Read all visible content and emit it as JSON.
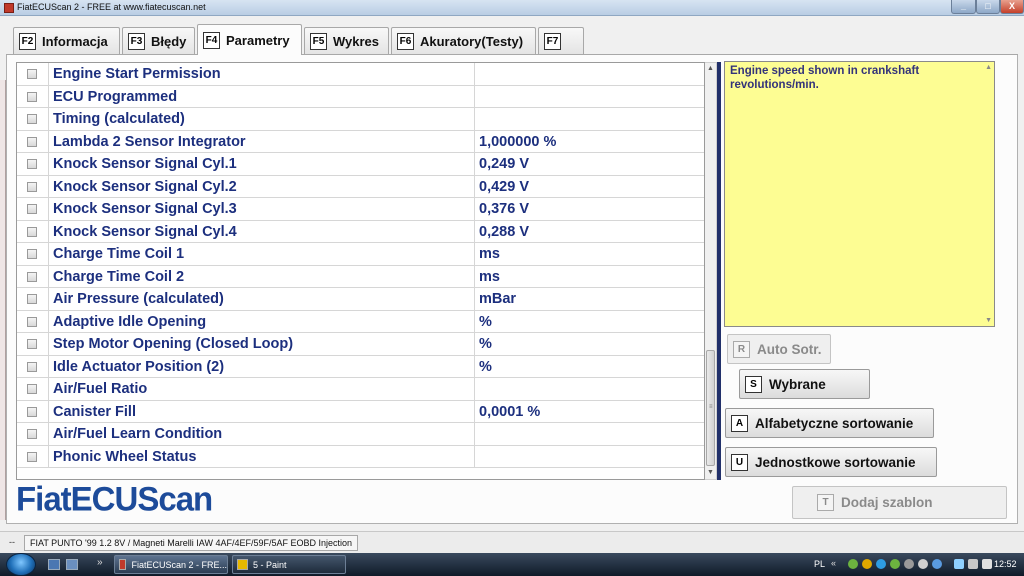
{
  "window": {
    "title": "FiatECUScan 2 - FREE at www.fiatecuscan.net",
    "min_label": "_",
    "max_label": "□",
    "close_label": "X"
  },
  "tabs": [
    {
      "key": "F2",
      "label": "Informacja"
    },
    {
      "key": "F3",
      "label": "Błędy"
    },
    {
      "key": "F4",
      "label": "Parametry"
    },
    {
      "key": "F5",
      "label": "Wykres"
    },
    {
      "key": "F6",
      "label": "Akuratory(Testy)"
    },
    {
      "key": "F7",
      "label": ""
    }
  ],
  "active_tab": "Parametry",
  "parameters": [
    {
      "name": "Engine Start Permission",
      "value": ""
    },
    {
      "name": "ECU Programmed",
      "value": ""
    },
    {
      "name": "Timing (calculated)",
      "value": ""
    },
    {
      "name": "Lambda 2 Sensor Integrator",
      "value": "1,000000 %"
    },
    {
      "name": "Knock Sensor Signal Cyl.1",
      "value": "0,249 V"
    },
    {
      "name": "Knock Sensor Signal Cyl.2",
      "value": "0,429 V"
    },
    {
      "name": "Knock Sensor Signal Cyl.3",
      "value": "0,376 V"
    },
    {
      "name": "Knock Sensor Signal Cyl.4",
      "value": "0,288 V"
    },
    {
      "name": "Charge Time Coil 1",
      "value": " ms"
    },
    {
      "name": "Charge Time Coil 2",
      "value": " ms"
    },
    {
      "name": "Air Pressure (calculated)",
      "value": " mBar"
    },
    {
      "name": "Adaptive Idle Opening",
      "value": " %"
    },
    {
      "name": "Step Motor Opening (Closed Loop)",
      "value": " %"
    },
    {
      "name": "Idle Actuator Position (2)",
      "value": " %"
    },
    {
      "name": "Air/Fuel Ratio",
      "value": ""
    },
    {
      "name": "Canister Fill",
      "value": "0,0001 %"
    },
    {
      "name": "Air/Fuel Learn Condition",
      "value": ""
    },
    {
      "name": "Phonic Wheel Status",
      "value": ""
    }
  ],
  "description": {
    "text": "Engine speed shown in crankshaft revolutions/min."
  },
  "buttons": {
    "auto_sort": {
      "key": "R",
      "label": "Auto Sotr."
    },
    "selected": {
      "key": "S",
      "label": "Wybrane"
    },
    "alpha_sort": {
      "key": "A",
      "label": "Alfabetyczne sortowanie"
    },
    "unit_sort": {
      "key": "U",
      "label": "Jednostkowe sortowanie"
    },
    "add_template": {
      "key": "T",
      "label": "Dodaj szablon"
    }
  },
  "logo": "FiatECUScan",
  "status": {
    "dash": "--",
    "vehicle": "FIAT PUNTO '99 1.2 8V / Magneti Marelli IAW 4AF/4EF/59F/5AF EOBD Injection"
  },
  "taskbar": {
    "tasks": [
      {
        "label": "FiatECUScan 2 - FRE..."
      },
      {
        "label": "5 - Paint"
      }
    ],
    "language": "PL",
    "clock": "12:52"
  }
}
